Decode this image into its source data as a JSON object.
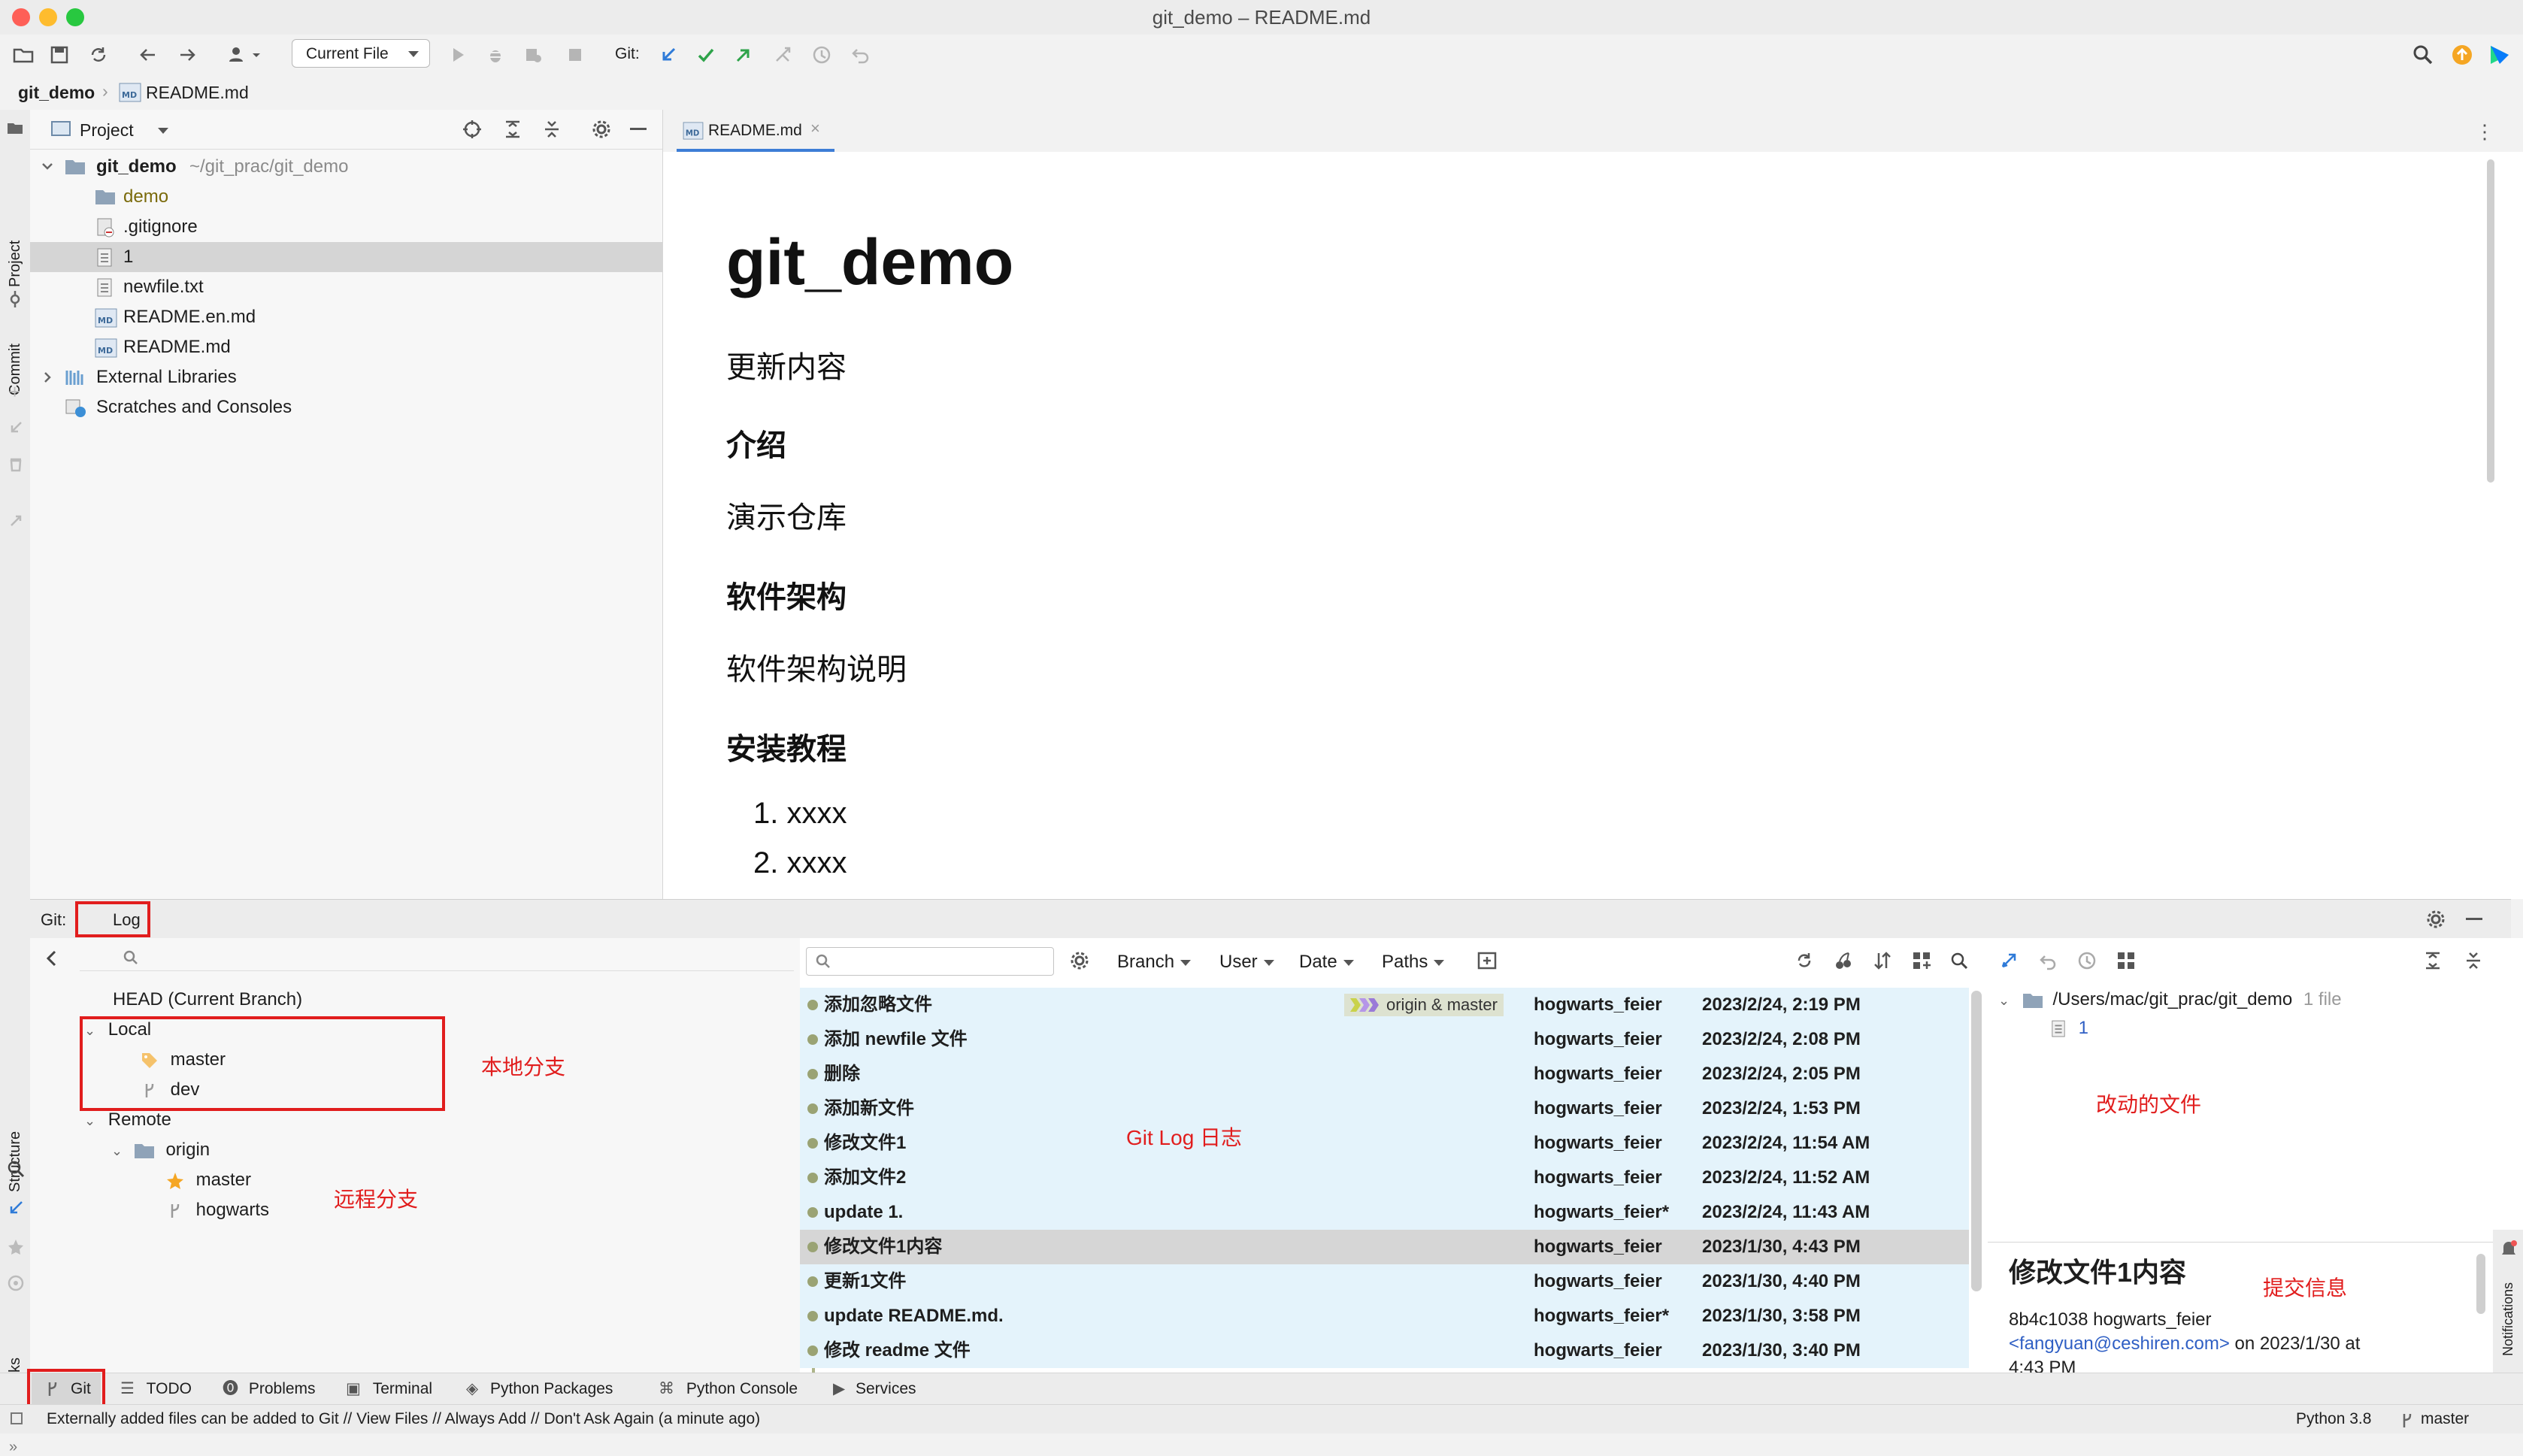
{
  "window": {
    "title": "git_demo – README.md"
  },
  "toolbar": {
    "run_config": "Current File",
    "git_label": "Git:"
  },
  "breadcrumb": {
    "project": "git_demo",
    "file": "README.md"
  },
  "left_stripe": {
    "project": "Project",
    "commit": "Commit",
    "structure": "Structure",
    "bookmarks": "Bookmarks"
  },
  "right_stripe": {
    "notifications": "Notifications"
  },
  "project_panel": {
    "title": "Project",
    "root_name": "git_demo",
    "root_path": "~/git_prac/git_demo",
    "items": [
      {
        "label": "demo",
        "icon": "folder-icon"
      },
      {
        "label": ".gitignore",
        "icon": "gitignore-file-icon"
      },
      {
        "label": "1",
        "icon": "text-file-icon"
      },
      {
        "label": "newfile.txt",
        "icon": "text-file-icon"
      },
      {
        "label": "README.en.md",
        "icon": "markdown-file-icon"
      },
      {
        "label": "README.md",
        "icon": "markdown-file-icon"
      }
    ],
    "external_libraries": "External Libraries",
    "scratches": "Scratches and Consoles"
  },
  "editor": {
    "tab_label": "README.md",
    "h1": "git_demo",
    "intro_text": "更新内容",
    "h_intro": "介绍",
    "p_intro": "演示仓库",
    "h_arch": "软件架构",
    "p_arch": "软件架构说明",
    "h_install": "安装教程",
    "list": [
      "xxxx",
      "xxxx"
    ]
  },
  "git_window": {
    "label": "Git:",
    "tab": "Log",
    "branches": {
      "head": "HEAD (Current Branch)",
      "local": "Local",
      "local_branches": [
        "master",
        "dev"
      ],
      "remote": "Remote",
      "origin": "origin",
      "remote_branches": [
        "master",
        "hogwarts"
      ]
    },
    "log_filters": {
      "branch": "Branch",
      "user": "User",
      "date": "Date",
      "paths": "Paths"
    },
    "commits": [
      {
        "message": "添加忽略文件",
        "author": "hogwarts_feier",
        "date": "2023/2/24, 2:19 PM",
        "refs": "origin & master"
      },
      {
        "message": "添加 newfile 文件",
        "author": "hogwarts_feier",
        "date": "2023/2/24, 2:08 PM"
      },
      {
        "message": "删除",
        "author": "hogwarts_feier",
        "date": "2023/2/24, 2:05 PM"
      },
      {
        "message": "添加新文件",
        "author": "hogwarts_feier",
        "date": "2023/2/24, 1:53 PM"
      },
      {
        "message": "修改文件1",
        "author": "hogwarts_feier",
        "date": "2023/2/24, 11:54 AM"
      },
      {
        "message": "添加文件2",
        "author": "hogwarts_feier",
        "date": "2023/2/24, 11:52 AM"
      },
      {
        "message": "update 1.",
        "author": "hogwarts_feier*",
        "date": "2023/2/24, 11:43 AM"
      },
      {
        "message": "修改文件1内容",
        "author": "hogwarts_feier",
        "date": "2023/1/30, 4:43 PM",
        "selected": true
      },
      {
        "message": "更新1文件",
        "author": "hogwarts_feier",
        "date": "2023/1/30, 4:40 PM"
      },
      {
        "message": "update README.md.",
        "author": "hogwarts_feier*",
        "date": "2023/1/30, 3:58 PM"
      },
      {
        "message": "修改 readme 文件",
        "author": "hogwarts_feier",
        "date": "2023/1/30, 3:40 PM"
      }
    ],
    "changes": {
      "path": "/Users/mac/git_prac/git_demo",
      "count": "1 file",
      "file": "1"
    },
    "details": {
      "title": "修改文件1内容",
      "hash_author": "8b4c1038 hogwarts_feier",
      "email": "<fangyuan@ceshiren.com>",
      "on_date": "on 2023/1/30 at",
      "time_partial": "4:43 PM"
    }
  },
  "annotations": {
    "local": "本地分支",
    "remote": "远程分支",
    "log": "Git Log 日志",
    "changed_files": "改动的文件",
    "commit_info": "提交信息"
  },
  "bottom_tabs": [
    "Git",
    "TODO",
    "Problems",
    "Terminal",
    "Python Packages",
    "Python Console",
    "Services"
  ],
  "status": {
    "message": "Externally added files can be added to Git // View Files // Always Add // Don't Ask Again (a minute ago)",
    "python": "Python 3.8",
    "branch": "master"
  },
  "colors": {
    "accent": "#2f7bd8",
    "annotation": "#e11d1d",
    "log_row_bg": "#e4f3fb",
    "selected_row": "#d6d6d6"
  }
}
